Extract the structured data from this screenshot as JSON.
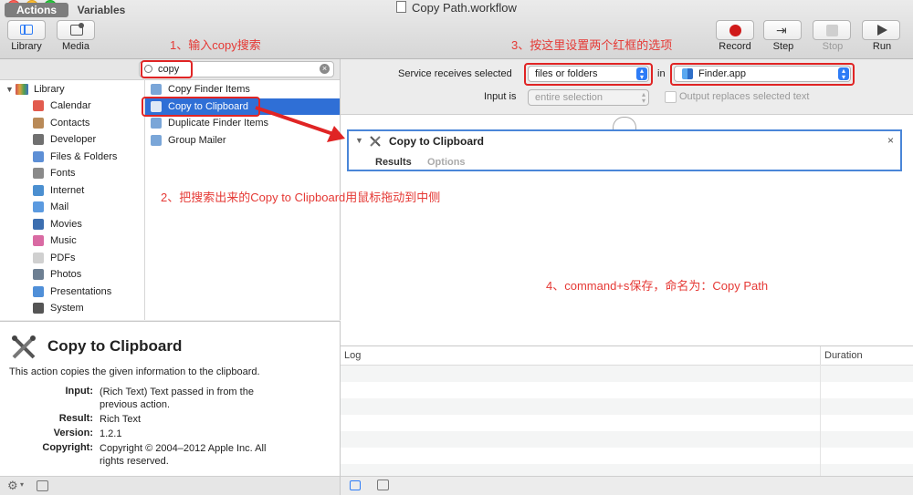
{
  "window": {
    "title": "Copy Path.workflow"
  },
  "toolbar": {
    "library_label": "Library",
    "media_label": "Media",
    "record_label": "Record",
    "step_label": "Step",
    "stop_label": "Stop",
    "run_label": "Run"
  },
  "left": {
    "tab_actions": "Actions",
    "tab_variables": "Variables",
    "search_value": "copy",
    "library_root": "Library",
    "library_items": [
      {
        "label": "Calendar",
        "color": "#e25b4e"
      },
      {
        "label": "Contacts",
        "color": "#b98a58"
      },
      {
        "label": "Developer",
        "color": "#707070"
      },
      {
        "label": "Files & Folders",
        "color": "#5d8fd6"
      },
      {
        "label": "Fonts",
        "color": "#8a8a8a"
      },
      {
        "label": "Internet",
        "color": "#4b8fd0"
      },
      {
        "label": "Mail",
        "color": "#5b9ae0"
      },
      {
        "label": "Movies",
        "color": "#3c6eb0"
      },
      {
        "label": "Music",
        "color": "#d96aa3"
      },
      {
        "label": "PDFs",
        "color": "#d0d0d0"
      },
      {
        "label": "Photos",
        "color": "#6d7f92"
      },
      {
        "label": "Presentations",
        "color": "#4f8fd8"
      },
      {
        "label": "System",
        "color": "#555555"
      }
    ],
    "results": [
      {
        "label": "Copy Finder Items",
        "selected": false
      },
      {
        "label": "Copy to Clipboard",
        "selected": true
      },
      {
        "label": "Duplicate Finder Items",
        "selected": false
      },
      {
        "label": "Group Mailer",
        "selected": false
      }
    ]
  },
  "description": {
    "title": "Copy to Clipboard",
    "summary": "This action copies the given information to the clipboard.",
    "input_label": "Input:",
    "input_value": "(Rich Text) Text passed in from the previous action.",
    "result_label": "Result:",
    "result_value": "Rich Text",
    "version_label": "Version:",
    "version_value": "1.2.1",
    "copyright_label": "Copyright:",
    "copyright_value": "Copyright © 2004–2012 Apple Inc.  All rights reserved."
  },
  "service": {
    "receives_label": "Service receives selected",
    "receives_value": "files or folders",
    "in_label": "in",
    "app_value": "Finder.app",
    "input_is_label": "Input is",
    "input_is_value": "entire selection",
    "output_replaces_label": "Output replaces selected text"
  },
  "action_card": {
    "title": "Copy to Clipboard",
    "tab_results": "Results",
    "tab_options": "Options"
  },
  "log": {
    "col_log": "Log",
    "col_duration": "Duration"
  },
  "annotations": {
    "step1": "1、输入copy搜索",
    "step2": "2、把搜索出来的Copy to Clipboard用鼠标拖动到中侧",
    "step3": "3、按这里设置两个红框的选项",
    "step4": "4、command+s保存，命名为：Copy Path"
  },
  "colors": {
    "accent": "#2e7cf6",
    "selection": "#2f6fd6",
    "annotation": "#e53935"
  }
}
